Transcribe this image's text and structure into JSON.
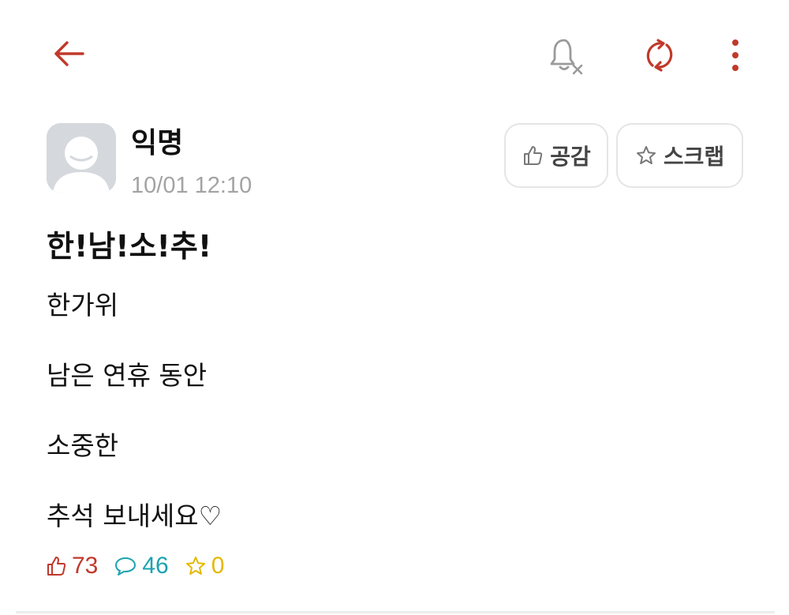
{
  "header": {
    "back_icon": "arrow-left-icon",
    "bell_icon": "bell-off-icon",
    "refresh_icon": "refresh-icon",
    "more_icon": "more-vertical-icon",
    "accent_color": "#c0392b"
  },
  "post": {
    "author": "익명",
    "time": "10/01 12:10",
    "like_button_label": "공감",
    "scrap_button_label": "스크랩",
    "title": "한!남!소!추!",
    "body_lines": [
      "한가위",
      "남은 연휴 동안",
      "소중한",
      "추석 보내세요♡"
    ],
    "stats": {
      "likes": "73",
      "comments": "46",
      "scraps": "0",
      "like_color": "#c0392b",
      "comment_color": "#1aa3b0",
      "scrap_color": "#e6b800"
    }
  }
}
